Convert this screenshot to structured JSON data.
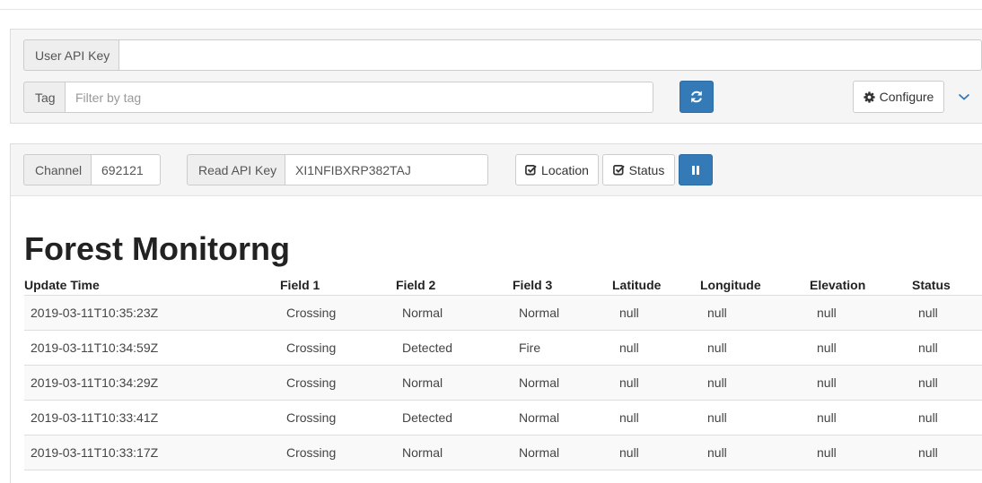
{
  "settings": {
    "user_api_key_label": "User API Key",
    "user_api_key_value": "",
    "tag_label": "Tag",
    "tag_placeholder": "Filter by tag",
    "refresh_icon": "refresh-icon",
    "configure_label": "Configure",
    "configure_icon": "gear-icon",
    "collapse_icon": "chevron-down-icon"
  },
  "channel_bar": {
    "channel_label": "Channel",
    "channel_value": "692121",
    "read_api_key_label": "Read API Key",
    "read_api_key_value": "XI1NFIBXRP382TAJ",
    "location_label": "Location",
    "status_label": "Status",
    "pause_icon": "pause-icon"
  },
  "main": {
    "title": "Forest Monitorng",
    "table": {
      "columns": [
        "Update Time",
        "Field 1",
        "Field 2",
        "Field 3",
        "Latitude",
        "Longitude",
        "Elevation",
        "Status"
      ],
      "rows": [
        [
          "2019-03-11T10:35:23Z",
          "Crossing",
          "Normal",
          "Normal",
          "null",
          "null",
          "null",
          "null"
        ],
        [
          "2019-03-11T10:34:59Z",
          "Crossing",
          "Detected",
          "Fire",
          "null",
          "null",
          "null",
          "null"
        ],
        [
          "2019-03-11T10:34:29Z",
          "Crossing",
          "Normal",
          "Normal",
          "null",
          "null",
          "null",
          "null"
        ],
        [
          "2019-03-11T10:33:41Z",
          "Crossing",
          "Detected",
          "Normal",
          "null",
          "null",
          "null",
          "null"
        ],
        [
          "2019-03-11T10:33:17Z",
          "Crossing",
          "Normal",
          "Normal",
          "null",
          "null",
          "null",
          "null"
        ]
      ]
    }
  },
  "colors": {
    "primary": "#337ab7",
    "panel_bg": "#f5f5f5",
    "addon_bg": "#eeeeee",
    "striped_row": "#f9f9f9"
  }
}
